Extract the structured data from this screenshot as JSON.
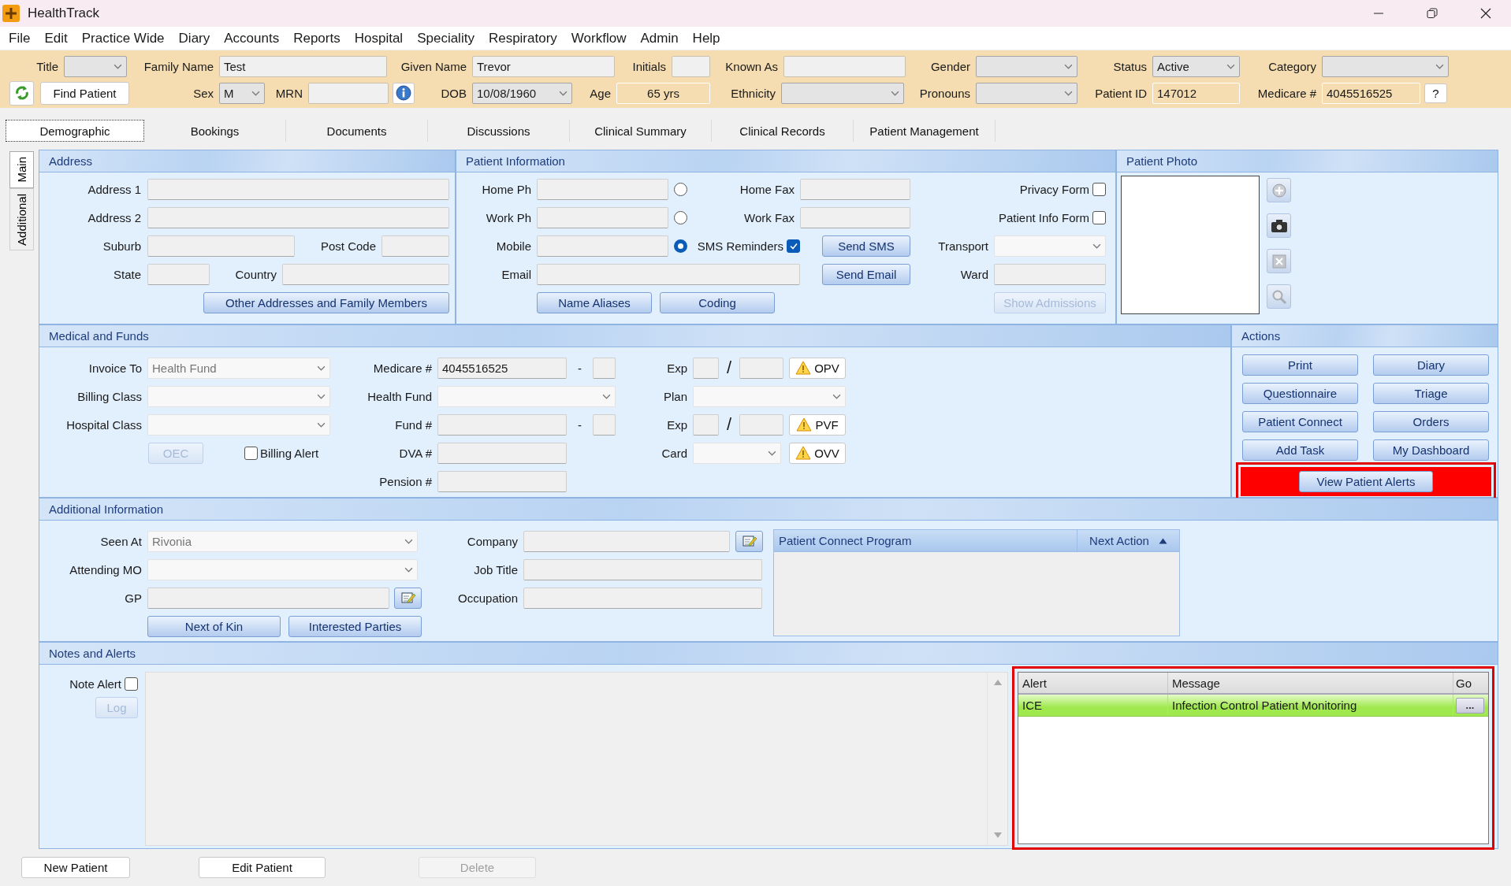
{
  "window": {
    "title": "HealthTrack"
  },
  "menu": [
    "File",
    "Edit",
    "Practice Wide",
    "Diary",
    "Accounts",
    "Reports",
    "Hospital",
    "Speciality",
    "Respiratory",
    "Workflow",
    "Admin",
    "Help"
  ],
  "header": {
    "row_1": [
      {
        "label": "Title",
        "kind": "combo",
        "readonly": false
      },
      {
        "label": "Family Name",
        "kind": "text",
        "value": "Test",
        "readonly": false
      },
      {
        "label": "Given Name",
        "kind": "text",
        "value": "Trevor",
        "readonly": false
      },
      {
        "label": "Initials",
        "kind": "text",
        "readonly": false
      },
      {
        "label": "Known As",
        "kind": "text",
        "readonly": false
      },
      {
        "label": "Gender",
        "kind": "combo",
        "readonly": false
      },
      {
        "label": "Status",
        "kind": "combo",
        "value": "Active",
        "readonly": false
      },
      {
        "label": "Category",
        "kind": "combo",
        "readonly": false
      }
    ],
    "find_button": "Find Patient",
    "row_2": [
      {
        "label": "Sex",
        "kind": "combo",
        "value": "M",
        "readonly": false
      },
      {
        "label": "MRN",
        "kind": "text",
        "readonly": false
      },
      {
        "label": "DOB",
        "kind": "combo",
        "value": "10/08/1960",
        "readonly": false
      },
      {
        "label": "Age",
        "kind": "text",
        "value": "65 yrs",
        "readonly": true
      },
      {
        "label": "Ethnicity",
        "kind": "combo",
        "readonly": false
      },
      {
        "label": "Pronouns",
        "kind": "combo",
        "readonly": false
      },
      {
        "label": "Patient ID",
        "kind": "text",
        "value": "147012",
        "readonly": true
      },
      {
        "label": "Medicare #",
        "kind": "text",
        "value": "4045516525",
        "readonly": true
      }
    ],
    "help_button": "?"
  },
  "tabs": [
    {
      "label": "Demographic",
      "selected": true
    },
    {
      "label": "Bookings",
      "selected": false
    },
    {
      "label": "Documents",
      "selected": false
    },
    {
      "label": "Discussions",
      "selected": false
    },
    {
      "label": "Clinical Summary",
      "selected": false
    },
    {
      "label": "Clinical Records",
      "selected": false
    },
    {
      "label": "Patient Management",
      "selected": false
    }
  ],
  "side_tabs": [
    {
      "label": "Main",
      "selected": true
    },
    {
      "label": "Additional",
      "selected": false
    }
  ],
  "address": {
    "title": "Address",
    "fields": [
      "Address 1",
      "Address 2",
      "Suburb",
      "Post Code",
      "State",
      "Country"
    ],
    "button": "Other Addresses and Family Members"
  },
  "patient_info": {
    "title": "Patient Information",
    "phones": [
      {
        "label": "Home Ph",
        "selected": false
      },
      {
        "label": "Work Ph",
        "selected": false
      },
      {
        "label": "Mobile",
        "selected": true
      }
    ],
    "faxes": [
      "Home Fax",
      "Work Fax"
    ],
    "forms": [
      {
        "label": "Privacy Form",
        "checked": false
      },
      {
        "label": "Patient Info Form",
        "checked": false
      }
    ],
    "sms_reminders": {
      "label": "SMS Reminders",
      "checked": true
    },
    "send_sms": "Send SMS",
    "email": "Email",
    "send_email": "Send Email",
    "buttons": [
      "Name Aliases",
      "Coding"
    ],
    "transport": "Transport",
    "ward": "Ward",
    "show_admissions": {
      "label": "Show Admissions",
      "disabled": true
    }
  },
  "patient_photo": {
    "title": "Patient Photo"
  },
  "medical": {
    "title": "Medical and Funds",
    "col_1": [
      {
        "kind": "combo",
        "label": "Invoice To",
        "value": "Health Fund"
      },
      {
        "kind": "combo",
        "label": "Billing Class"
      },
      {
        "kind": "combo",
        "label": "Hospital Class"
      }
    ],
    "oec": {
      "label": "OEC",
      "disabled": true
    },
    "billing_alert": {
      "label": "Billing Alert",
      "checked": false
    },
    "col_2": [
      {
        "kind": "split",
        "label": "Medicare #",
        "value": "4045516525",
        "separator": "-"
      },
      {
        "kind": "combo",
        "label": "Health Fund"
      },
      {
        "kind": "split",
        "label": "Fund #",
        "separator": "-"
      },
      {
        "kind": "text",
        "label": "DVA #"
      },
      {
        "kind": "text",
        "label": "Pension #"
      }
    ],
    "col_3": [
      {
        "kind": "expiry",
        "label": "Exp",
        "separator": "/",
        "button": "OPV"
      },
      {
        "kind": "combo",
        "label": "Plan"
      },
      {
        "kind": "expiry",
        "label": "Exp",
        "separator": "/",
        "button": "PVF"
      },
      {
        "kind": "card",
        "label": "Card",
        "button": "OVV"
      }
    ]
  },
  "actions": {
    "title": "Actions",
    "buttons": [
      "Print",
      "Diary",
      "Questionnaire",
      "Triage",
      "Patient Connect",
      "Orders",
      "Add Task",
      "My Dashboard"
    ],
    "alerts_button": {
      "label": "View Patient Alerts",
      "highlighted": true
    }
  },
  "additional": {
    "title": "Additional Information",
    "col_1": [
      {
        "kind": "combo",
        "label": "Seen At",
        "value": "Rivonia"
      },
      {
        "kind": "combo",
        "label": "Attending MO"
      },
      {
        "kind": "edit",
        "label": "GP"
      }
    ],
    "buttons": [
      "Next of Kin",
      "Interested Parties"
    ],
    "col_2": [
      {
        "kind": "edit",
        "label": "Company"
      },
      {
        "kind": "text",
        "label": "Job Title"
      },
      {
        "kind": "text",
        "label": "Occupation"
      }
    ],
    "program_table": {
      "columns": [
        {
          "label": "Patient Connect Program",
          "sorted": false
        },
        {
          "label": "Next Action",
          "sorted": true
        }
      ]
    }
  },
  "notes": {
    "title": "Notes and Alerts",
    "note_alert": {
      "label": "Note Alert",
      "checked": false
    },
    "log": {
      "label": "Log",
      "disabled": true
    },
    "alerts_table": {
      "highlighted": true,
      "columns": [
        "Alert",
        "Message",
        "Go"
      ],
      "rows": [
        {
          "alert": "ICE",
          "message": "Infection Control Patient Monitoring",
          "go": "...",
          "color": "#9fe84e"
        }
      ]
    }
  },
  "footer": [
    {
      "label": "New Patient",
      "disabled": false
    },
    {
      "label": "Edit Patient",
      "disabled": false
    },
    {
      "label": "Delete",
      "disabled": true
    }
  ]
}
